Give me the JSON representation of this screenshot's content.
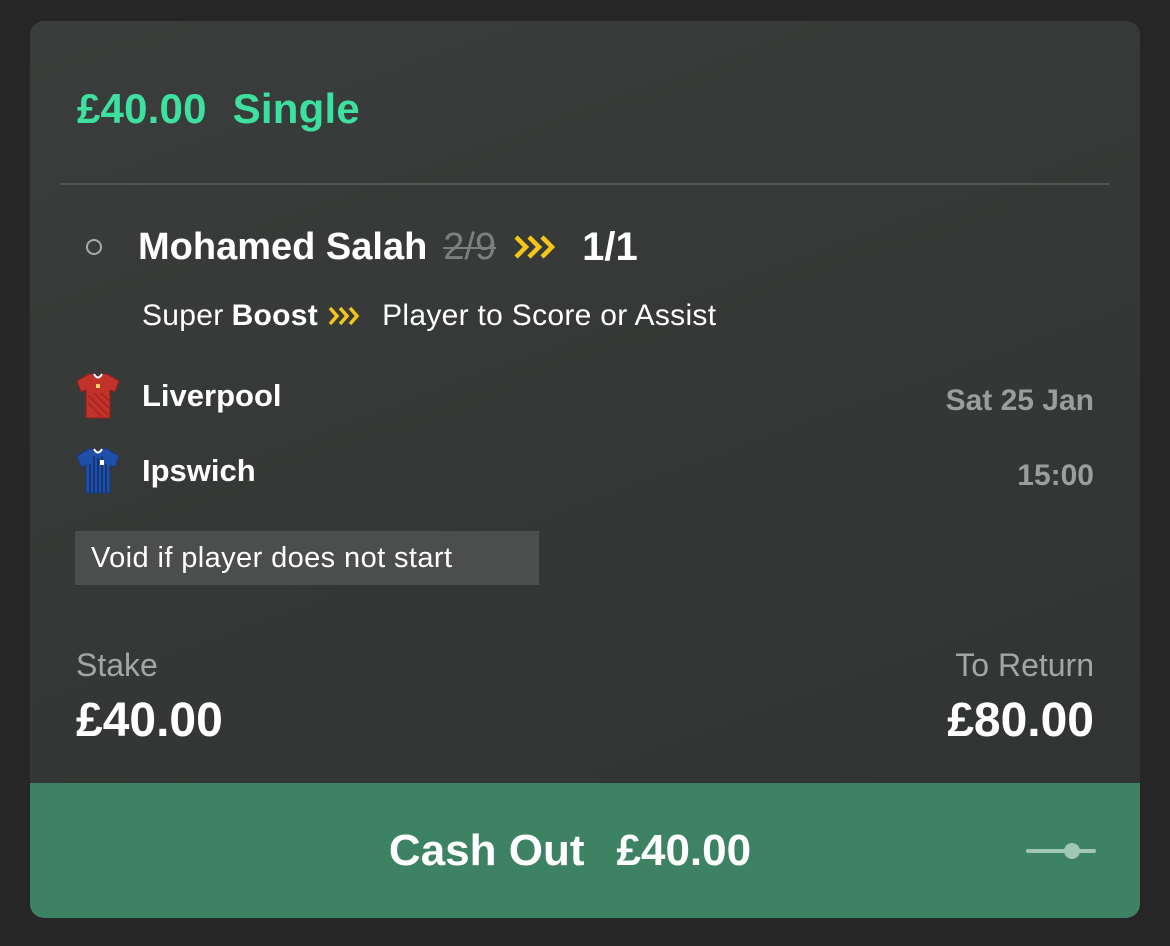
{
  "bet": {
    "stake_amount": "£40.00",
    "bet_type": "Single"
  },
  "selection": {
    "name": "Mohamed Salah",
    "old_odds": "2/9",
    "new_odds": "1/1",
    "market_prefix": "Super",
    "market_boost_word": "Boost",
    "market_name": "Player to Score or Assist",
    "boost_color": "#f5c518"
  },
  "event": {
    "home_team": "Liverpool",
    "away_team": "Ipswich",
    "date": "Sat 25 Jan",
    "time": "15:00",
    "home_kit_color": "#c0322a",
    "away_kit_color": "#1f4fa8"
  },
  "note": "Void if player does not start",
  "summary": {
    "stake_label": "Stake",
    "stake_value": "£40.00",
    "return_label": "To Return",
    "return_value": "£80.00"
  },
  "cashout": {
    "label": "Cash Out",
    "amount": "£40.00",
    "color": "#3e8264"
  },
  "colors": {
    "accent": "#3ee0a0",
    "background": "#262626",
    "card": "#353836"
  },
  "icons": {
    "status": "radio-icon",
    "boost": "boost-chevrons-icon",
    "home_kit": "shirt-icon",
    "away_kit": "shirt-icon",
    "cashout_slider": "slider-icon"
  }
}
